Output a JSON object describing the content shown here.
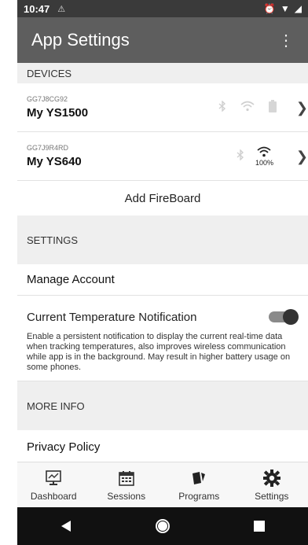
{
  "status_bar": {
    "time": "10:47",
    "warning_icon": "warning-icon",
    "alarm_icon": "alarm-icon",
    "wifi_icon": "wifi-icon",
    "signal_icon": "signal-icon"
  },
  "app_bar": {
    "title": "App Settings",
    "menu_icon": "more-vert-icon"
  },
  "devices": {
    "header": "DEVICES",
    "items": [
      {
        "serial": "GG7J8CG92",
        "name": "My YS1500",
        "wifi_percent": ""
      },
      {
        "serial": "GG7J9R4RD",
        "name": "My YS640",
        "wifi_percent": "100%"
      }
    ],
    "add_label": "Add FireBoard"
  },
  "settings": {
    "header": "SETTINGS",
    "manage_account": "Manage Account",
    "notification_title": "Current Temperature Notification",
    "notification_desc": "Enable a persistent notification to display the current real-time data when tracking temperatures, also improves wireless communication while app is in the background. May result in higher battery usage on some phones.",
    "notification_enabled": true
  },
  "more_info": {
    "header": "MORE INFO",
    "privacy_policy": "Privacy Policy"
  },
  "bottom_nav": {
    "items": [
      {
        "label": "Dashboard",
        "icon": "dashboard-icon"
      },
      {
        "label": "Sessions",
        "icon": "calendar-icon"
      },
      {
        "label": "Programs",
        "icon": "programs-icon"
      },
      {
        "label": "Settings",
        "icon": "gear-icon"
      }
    ]
  },
  "colors": {
    "app_bar": "#5e5e5e",
    "status_bar": "#3a3a3a",
    "section_bg": "#efefef",
    "toggle_knob": "#333333"
  }
}
